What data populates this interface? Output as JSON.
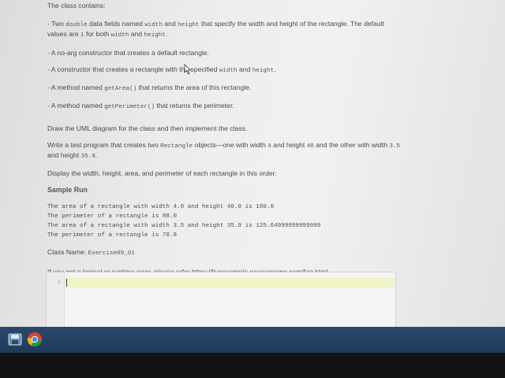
{
  "problem": {
    "intro": "The class contains:",
    "bullet1": {
      "a": "- Two ",
      "code1": "double",
      "b": " data fields named ",
      "code2": "width",
      "c": " and ",
      "code3": "height",
      "d": " that specify the width and height of the rectangle. The default values are ",
      "code4": "1",
      "e": " for both ",
      "code5": "width",
      "f": " and ",
      "code6": "height",
      "g": "."
    },
    "bullet2": "- A no-arg constructor that creates a default rectangle.",
    "bullet3": {
      "a": "- A constructor that creates a rectangle with the specified ",
      "code1": "width",
      "b": " and ",
      "code2": "height",
      "c": "."
    },
    "bullet4": {
      "a": "- A method named ",
      "code": "getArea()",
      "b": " that returns the area of this rectangle."
    },
    "bullet5": {
      "a": "- A method named ",
      "code": "getPerimeter()",
      "b": " that returns the perimeter."
    },
    "uml": "Draw the UML diagram for the class and then implement the class.",
    "test": {
      "a": "Write a test program that creates two ",
      "code1": "Rectangle",
      "b": " objects—one with width ",
      "code2": "4",
      "c": " and height ",
      "code3": "40",
      "d": " and the other with width ",
      "code4": "3.5",
      "e": " and height ",
      "code5": "35.9",
      "f": "."
    },
    "display": "Display the width, height, area, and perimeter of each rectangle in this order.",
    "sample_heading": "Sample Run",
    "sample_output": [
      "The area of a rectangle with width 4.0 and height 40.0 is 160.0",
      "The perimeter of a rectangle is 88.0",
      "The area of a rectangle with width 3.5 and height 35.9 is 125.64999999999999",
      "The perimeter of a rectangle is 78.8"
    ],
    "class_name_label": "Class Name: ",
    "class_name": "Exercise09_01",
    "help": "If you get a logical or runtime error, please refer https://liveexample.pearsoncmg.com/faq.html."
  },
  "editor": {
    "line_numbers": [
      "1"
    ],
    "content": ""
  },
  "taskbar": {
    "icons": [
      "save-app-icon",
      "chrome-icon"
    ]
  }
}
